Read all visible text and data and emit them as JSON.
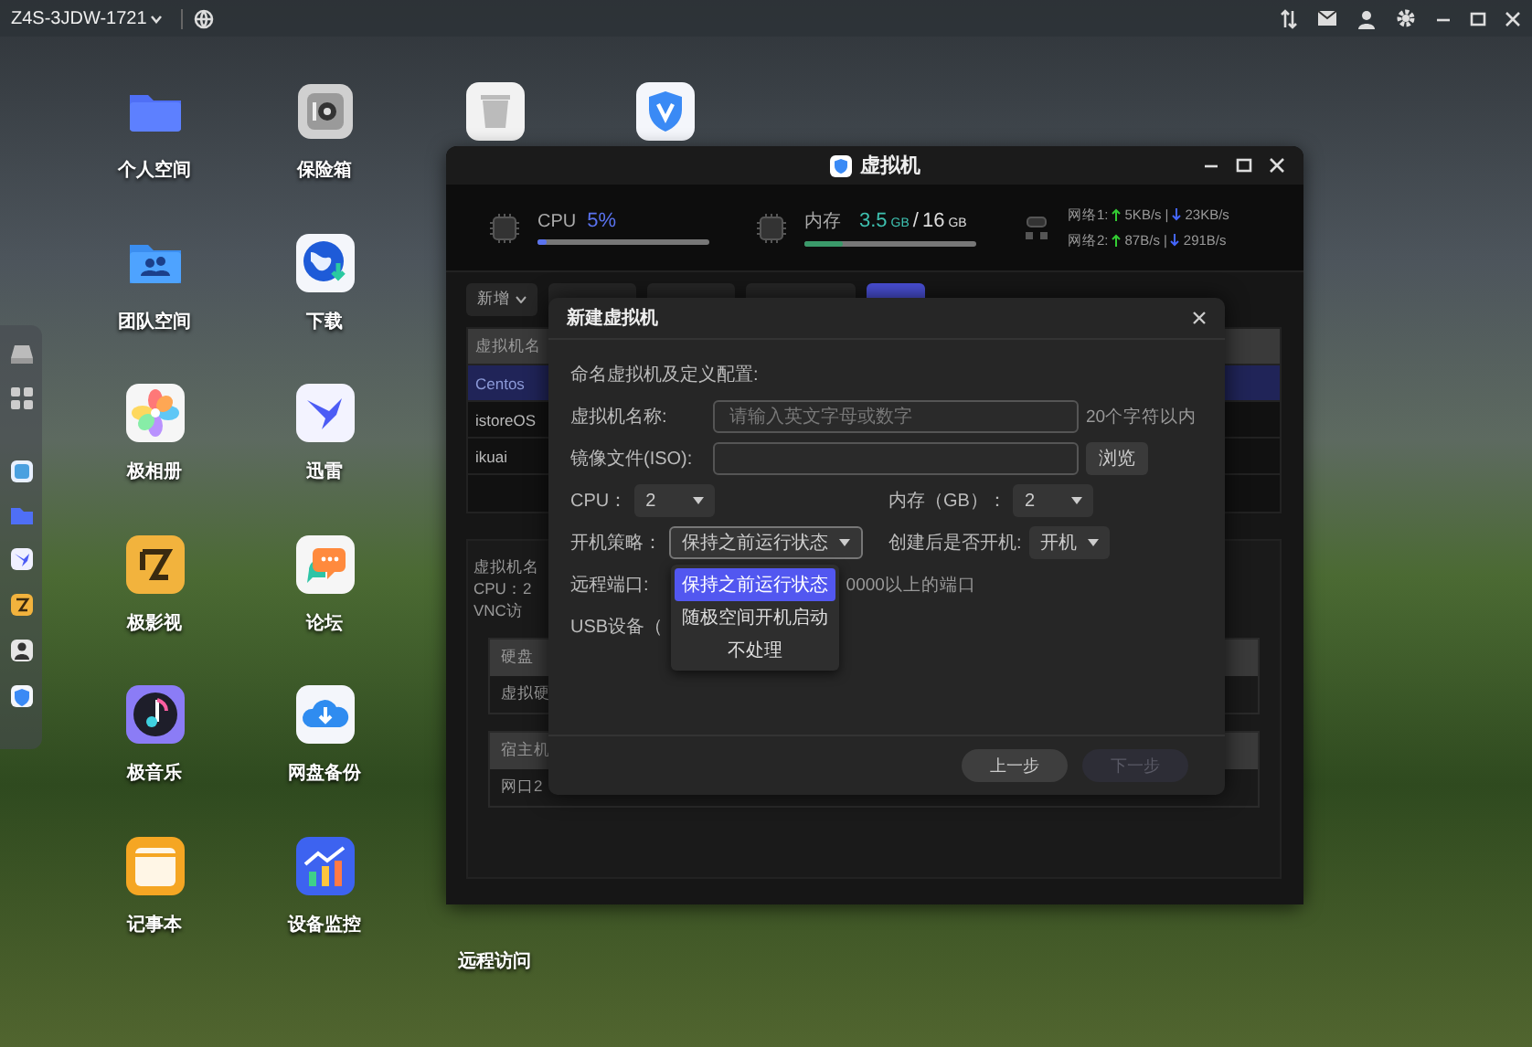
{
  "top_bar": {
    "device_name": "Z4S-3JDW-1721"
  },
  "desktop_icons": [
    {
      "label": "个人空间"
    },
    {
      "label": "保险箱"
    },
    {
      "label": "团队空间"
    },
    {
      "label": "下载"
    },
    {
      "label": "极相册"
    },
    {
      "label": "迅雷"
    },
    {
      "label": "极影视"
    },
    {
      "label": "论坛"
    },
    {
      "label": "极音乐"
    },
    {
      "label": "网盘备份"
    },
    {
      "label": "记事本"
    },
    {
      "label": "设备监控"
    },
    {
      "label": "远程访问"
    }
  ],
  "vm_window": {
    "title": "虚拟机",
    "stats": {
      "cpu": {
        "label": "CPU",
        "value": "5%",
        "level": 0.05
      },
      "memory": {
        "label": "内存",
        "used": "3.5",
        "used_unit": "GB",
        "separator": "/",
        "total": "16",
        "total_unit": "GB",
        "level": 0.22
      },
      "network": [
        {
          "label": "网络1:",
          "up": "5KB/s",
          "separator": "|",
          "down": "23KB/s"
        },
        {
          "label": "网络2:",
          "up": "87B/s",
          "separator": "|",
          "down": "291B/s"
        }
      ]
    },
    "toolbar": {
      "add_button": "新增"
    },
    "vm_list": {
      "header": "虚拟机名",
      "rows": [
        {
          "name": "Centos",
          "selected": true
        },
        {
          "name": "istoreOS",
          "selected": false
        },
        {
          "name": "ikuai",
          "selected": false
        }
      ]
    },
    "details": {
      "lines": [
        "虚拟机名",
        "CPU：2",
        "VNC访"
      ],
      "disk_table": {
        "header": "硬盘",
        "cell": "虚拟硬"
      },
      "host_table": {
        "header": "宿主机",
        "cell": "网口2"
      }
    }
  },
  "dialog": {
    "title": "新建虚拟机",
    "section_label": "命名虚拟机及定义配置:",
    "name_field": {
      "label": "虚拟机名称:",
      "placeholder": "请输入英文字母或数字",
      "hint": "20个字符以内"
    },
    "iso_field": {
      "label": "镜像文件(ISO):",
      "browse_button": "浏览"
    },
    "cpu": {
      "label": "CPU：",
      "value": "2"
    },
    "memory": {
      "label": "内存（GB）：",
      "value": "2"
    },
    "boot_policy": {
      "label": "开机策略：",
      "value": "保持之前运行状态",
      "expanded": true,
      "options": [
        {
          "label": "保持之前运行状态",
          "selected": true
        },
        {
          "label": "随极空间开机启动",
          "selected": false
        },
        {
          "label": "不处理",
          "selected": false
        }
      ]
    },
    "auto_start": {
      "label": "创建后是否开机:",
      "value": "开机"
    },
    "remote_port": {
      "label": "远程端口:",
      "hint": "0000以上的端口"
    },
    "usb": {
      "label": "USB设备（"
    },
    "buttons": [
      {
        "label": "上一步",
        "disabled": false
      },
      {
        "label": "下一步",
        "disabled": true
      }
    ]
  }
}
